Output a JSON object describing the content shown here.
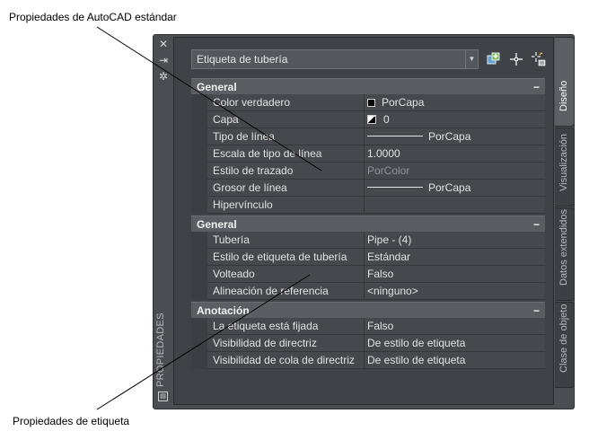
{
  "callouts": {
    "top": "Propiedades de AutoCAD estándar",
    "bottom": "Propiedades de etiqueta"
  },
  "palette": {
    "title": "PROPIEDADES",
    "selector": {
      "value": "Etiqueta de tubería"
    },
    "sections": [
      {
        "title": "General",
        "collapse": "−",
        "rows": [
          {
            "name": "Color verdadero",
            "value": "PorCapa"
          },
          {
            "name": "Capa",
            "value": "0"
          },
          {
            "name": "Tipo de línea",
            "value": "PorCapa"
          },
          {
            "name": "Escala de tipo de línea",
            "value": "1.0000"
          },
          {
            "name": "Estilo de trazado",
            "value": "PorColor"
          },
          {
            "name": "Grosor de línea",
            "value": "PorCapa"
          },
          {
            "name": "Hipervínculo",
            "value": ""
          }
        ]
      },
      {
        "title": "General",
        "collapse": "−",
        "rows": [
          {
            "name": "Tubería",
            "value": "Pipe - (4)"
          },
          {
            "name": "Estilo de etiqueta de tubería",
            "value": "Estándar"
          },
          {
            "name": "Volteado",
            "value": "Falso"
          },
          {
            "name": "Alineación de referencia",
            "value": "<ninguno>"
          }
        ]
      },
      {
        "title": "Anotación",
        "collapse": "−",
        "rows": [
          {
            "name": "La etiqueta está fijada",
            "value": "Falso"
          },
          {
            "name": "Visibilidad de directriz",
            "value": "De estilo de etiqueta"
          },
          {
            "name": "Visibilidad de cola de directriz",
            "value": "De estilo de etiqueta"
          }
        ]
      }
    ],
    "tabs": [
      "Diseño",
      "Visualización",
      "Datos extendidos",
      "Clase de objeto"
    ],
    "active_tab": "Diseño"
  }
}
